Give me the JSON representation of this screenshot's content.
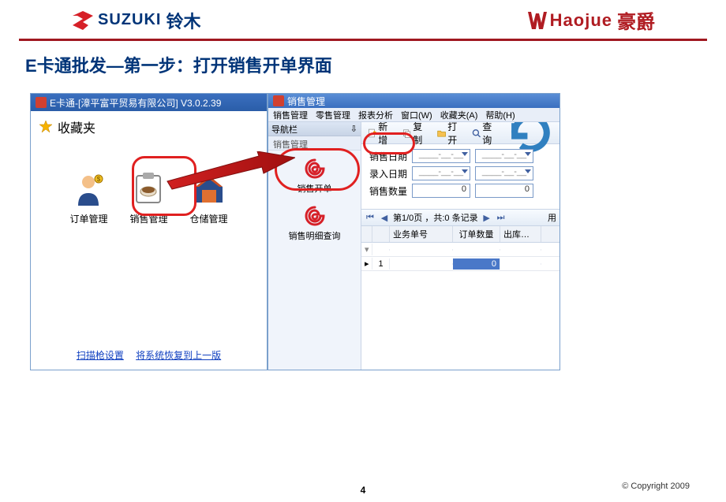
{
  "brands": {
    "suzuki_en": "SUZUKI",
    "suzuki_cn": "铃木",
    "haojue_en": "Haojue",
    "haojue_cn": "豪爵"
  },
  "slide": {
    "title_e": "E",
    "title_rest": "卡通批发—第一步：打开销售开单界面"
  },
  "left_window": {
    "title": "E卡通-[漳平富平贸易有限公司] V3.0.2.39",
    "favorites_label": "收藏夹",
    "icons": {
      "order": "订单管理",
      "sales": "销售管理",
      "warehouse": "仓储管理"
    },
    "links": {
      "scan": "扫描枪设置",
      "restore": "将系统恢复到上一版"
    }
  },
  "right_window": {
    "title": "销售管理",
    "menu": {
      "m1": "销售管理",
      "m2": "零售管理",
      "m3": "报表分析",
      "m4": "窗口(W)",
      "m5": "收藏夹(A)",
      "m6": "帮助(H)"
    },
    "nav_header": "导航栏",
    "nav_pin": "⇩",
    "nav_sub": "销售管理",
    "nav_items": {
      "open": "销售开单",
      "detail": "销售明细查询"
    },
    "toolbar": {
      "new": "新增",
      "copy": "复制",
      "open": "打开",
      "search": "查询"
    },
    "form": {
      "sale_date": "销售日期",
      "entry_date": "录入日期",
      "qty": "销售数量",
      "date_placeholder": "____-__-__",
      "qty1": "0",
      "qty2": "0"
    },
    "pager": {
      "text": "第1/0页 ，共:0 条记录",
      "user": "用"
    },
    "grid": {
      "h_no": "业务单号",
      "h_qty": "订单数量",
      "h_out": "出库…",
      "row_idx": "1",
      "row_qty": "0"
    }
  },
  "footer": {
    "page": "4",
    "copyright": "© Copyright  2009"
  }
}
